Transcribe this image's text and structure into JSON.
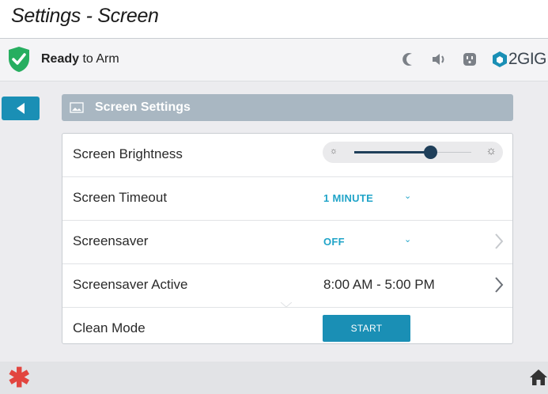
{
  "page_title": "Settings - Screen",
  "status": {
    "state_bold": "Ready",
    "state_rest": " to Arm",
    "brand": "2GIG",
    "accent_color": "#1a8fb5",
    "shield_color": "#27ae60"
  },
  "header": {
    "title": "Screen Settings",
    "icon": "picture-icon"
  },
  "rows": [
    {
      "label": "Screen Brightness",
      "control": "slider",
      "brightness_level": 0.65
    },
    {
      "label": "Screen Timeout",
      "control": "dropdown",
      "value": "1 MINUTE"
    },
    {
      "label": "Screensaver",
      "control": "dropdown",
      "value": "OFF",
      "has_chevron": true
    },
    {
      "label": "Screensaver Active",
      "value": "8:00 AM - 5:00 PM",
      "has_chevron": true
    },
    {
      "label": "Clean Mode",
      "button_label": "START"
    }
  ],
  "icons": {
    "status": [
      "moon-icon",
      "speaker-icon",
      "outlet-icon",
      "2gig-logo-icon"
    ],
    "bottom_left": "emergency-asterisk-icon",
    "bottom_right": "home-icon",
    "back": "back-arrow-icon"
  }
}
